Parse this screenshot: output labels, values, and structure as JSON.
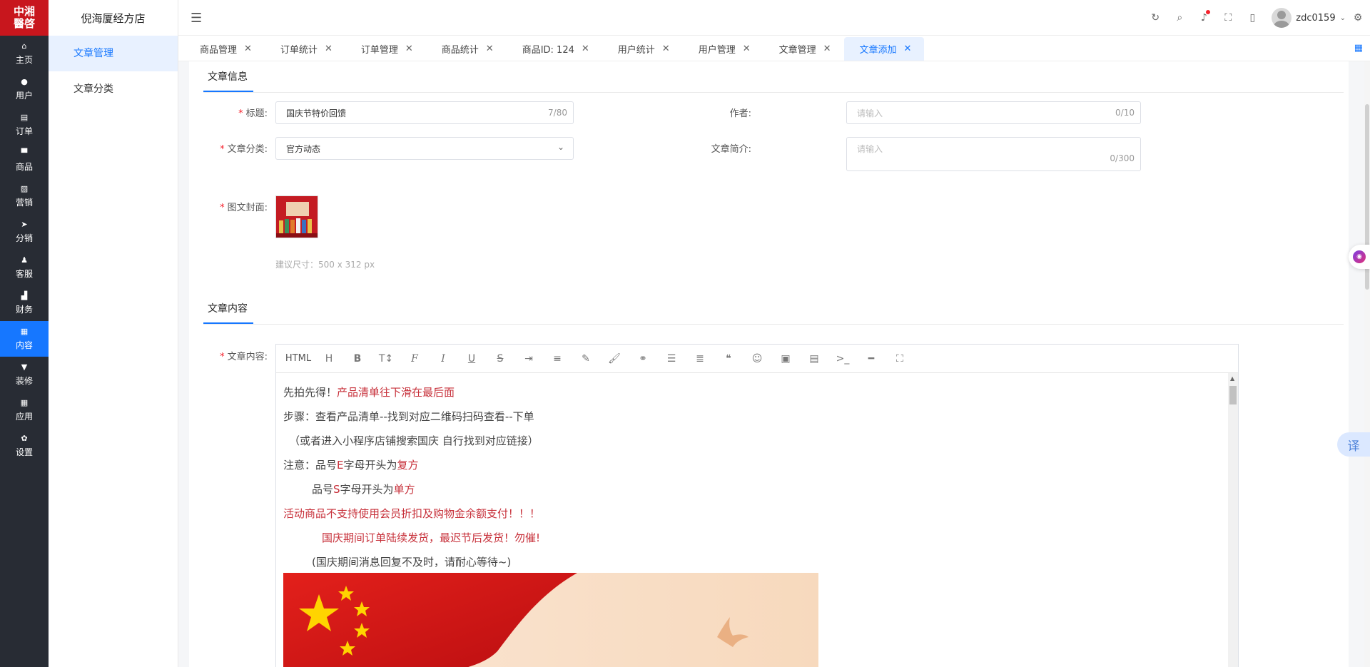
{
  "logo": {
    "text_top": "中湘",
    "text_bottom": "醫啓"
  },
  "rail": [
    {
      "icon": "home-icon",
      "glyph": "⌂",
      "label": "主页"
    },
    {
      "icon": "user-icon",
      "glyph": "●",
      "label": "用户"
    },
    {
      "icon": "order-icon",
      "glyph": "▤",
      "label": "订单"
    },
    {
      "icon": "product-icon",
      "glyph": "▀",
      "label": "商品"
    },
    {
      "icon": "marketing-icon",
      "glyph": "▨",
      "label": "营销"
    },
    {
      "icon": "distribution-icon",
      "glyph": "➤",
      "label": "分销"
    },
    {
      "icon": "service-icon",
      "glyph": "♟",
      "label": "客服"
    },
    {
      "icon": "finance-icon",
      "glyph": "▟",
      "label": "财务"
    },
    {
      "icon": "content-icon",
      "glyph": "▦",
      "label": "内容"
    },
    {
      "icon": "decorate-icon",
      "glyph": "▼",
      "label": "装修"
    },
    {
      "icon": "apps-icon",
      "glyph": "▦",
      "label": "应用"
    },
    {
      "icon": "settings-icon",
      "glyph": "✿",
      "label": "设置"
    }
  ],
  "rail_active_index": 8,
  "submenu": {
    "shop_name": "倪海厦经方店",
    "items": [
      {
        "label": "文章管理",
        "active": true
      },
      {
        "label": "文章分类",
        "active": false
      }
    ]
  },
  "header": {
    "username": "zdc0159",
    "icons": [
      "refresh-icon",
      "search-icon",
      "bell-icon",
      "fullscreen-icon",
      "mobile-icon"
    ]
  },
  "tabs": [
    {
      "label": "商品管理"
    },
    {
      "label": "订单统计"
    },
    {
      "label": "订单管理"
    },
    {
      "label": "商品统计"
    },
    {
      "label": "商品ID: 124"
    },
    {
      "label": "用户统计"
    },
    {
      "label": "用户管理"
    },
    {
      "label": "文章管理"
    },
    {
      "label": "文章添加"
    }
  ],
  "active_tab_index": 8,
  "form": {
    "section_info": "文章信息",
    "title_label": "标题:",
    "title_value": "国庆节特价回馈",
    "title_count": "7/80",
    "author_label": "作者:",
    "author_placeholder": "请输入",
    "author_count": "0/10",
    "category_label": "文章分类:",
    "category_value": "官方动态",
    "summary_label": "文章简介:",
    "summary_placeholder": "请输入",
    "summary_count": "0/300",
    "cover_label": "图文封面:",
    "cover_hint": "建议尺寸：500 x 312 px",
    "section_content": "文章内容",
    "content_label": "文章内容:"
  },
  "editor": {
    "toolbar_html": "HTML",
    "tools": [
      "heading-icon",
      "bold-icon",
      "font-size-icon",
      "font-family-icon",
      "italic-icon",
      "underline-icon",
      "strikethrough-icon",
      "indent-icon",
      "line-height-icon",
      "text-color-icon",
      "background-color-icon",
      "link-icon",
      "list-icon",
      "align-icon",
      "quote-icon",
      "emoji-icon",
      "image-icon",
      "video-icon",
      "code-icon",
      "divider-icon",
      "fullscreen-icon"
    ],
    "lines": {
      "l1a": "先拍先得！",
      "l1b": "产品清单往下滑在最后面",
      "l2": "步骤：查看产品清单--找到对应二维码扫码查看--下单",
      "l3": "（或者进入小程序店铺搜索国庆 自行找到对应链接）",
      "l4a": "注意：品号",
      "l4b": "E",
      "l4c": "字母开头为",
      "l4d": "复方",
      "l5a": "品号",
      "l5b": "S",
      "l5c": "字母开头为",
      "l5d": "单方",
      "l6": "活动商品不支持使用会员折扣及购物金余额支付！！！",
      "l7": "国庆期间订单陆续发货，最迟节后发货！勿催!",
      "l8": "(国庆期间消息回复不及时，请耐心等待~)"
    }
  },
  "floating": {
    "translate": "译"
  },
  "colors": {
    "primary": "#1677ff",
    "rail_bg": "#282c34",
    "logo_bg": "#c8161d",
    "emphasis": "#c7303a"
  }
}
